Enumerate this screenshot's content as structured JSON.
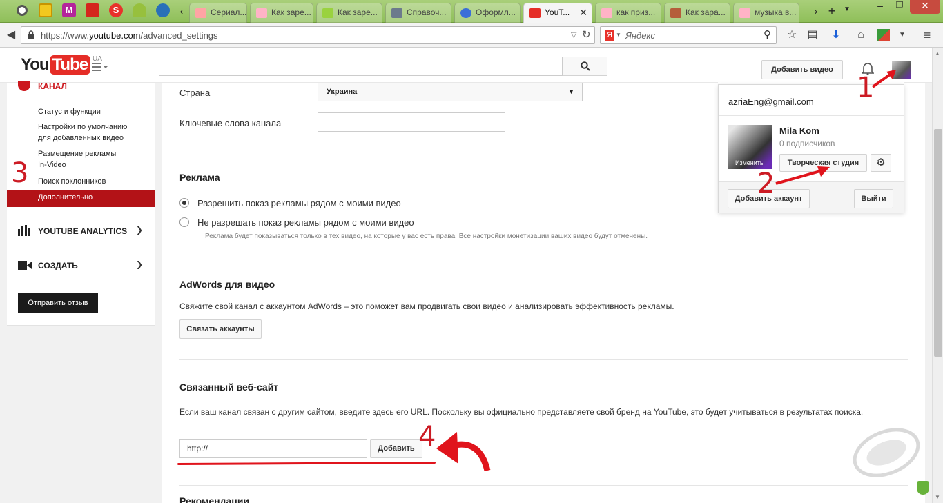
{
  "browser": {
    "tabs": [
      {
        "label": "Сериал...",
        "color": "#ffa4a4"
      },
      {
        "label": "Как заре...",
        "color": "#ffb3c6"
      },
      {
        "label": "Как заре...",
        "color": "#9ad23f"
      },
      {
        "label": "Справоч...",
        "color": "#6c7a8c"
      },
      {
        "label": "Оформл...",
        "color": "#3a6fd8"
      },
      {
        "label": "YouT...",
        "color": "#e52d27"
      },
      {
        "label": "как приз...",
        "color": "#ffb3c6"
      },
      {
        "label": "Как зара...",
        "color": "#b55d3a"
      },
      {
        "label": "музыка в...",
        "color": "#ffb3c6"
      }
    ],
    "url_prefix": "https://www.",
    "url_domain": "youtube.com",
    "url_path": "/advanced_settings",
    "yandex_placeholder": "Яндекс"
  },
  "header": {
    "logo_you": "You",
    "logo_tube": "Tube",
    "logo_region": "UA",
    "search_icon": "search-icon",
    "add_video": "Добавить видео"
  },
  "sidebar": {
    "section_channel": "КАНАЛ",
    "items": [
      "Статус и функции",
      "Настройки по умолчанию для добавленных видео",
      "Размещение рекламы In-Video",
      "Поиск поклонников",
      "Дополнительно"
    ],
    "analytics": "YOUTUBE ANALYTICS",
    "create": "СОЗДАТЬ",
    "feedback": "Отправить отзыв"
  },
  "main": {
    "country_label": "Страна",
    "country_value": "Украина",
    "keywords_label": "Ключевые слова канала",
    "ads_title": "Реклама",
    "ads_allow": "Разрешить показ рекламы рядом с моими видео",
    "ads_disallow": "Не разрешать показ рекламы рядом с моими видео",
    "ads_note": "Реклама будет показываться только в тех видео, на которые у вас есть права. Все настройки монетизации ваших видео будут отменены.",
    "adwords_title": "AdWords для видео",
    "adwords_text": "Свяжите свой канал с аккаунтом AdWords – это поможет вам продвигать свои видео и анализировать эффективность рекламы.",
    "adwords_button": "Связать аккаунты",
    "site_title": "Связанный веб-сайт",
    "site_text": "Если ваш канал связан с другим сайтом, введите здесь его URL. Поскольку вы официально представляете свой бренд на YouTube, это будет учитываться в результатах поиска.",
    "site_input": "http://",
    "site_button": "Добавить",
    "recommend_title": "Рекомендации"
  },
  "account": {
    "email": "azriaEng@gmail.com",
    "name": "Mila Kom",
    "subscribers": "0 подписчиков",
    "change": "Изменить",
    "studio": "Творческая студия",
    "add_account": "Добавить аккаунт",
    "logout": "Выйти"
  },
  "annotations": [
    "1",
    "2",
    "3",
    "4"
  ],
  "colors": {
    "youtube_red": "#e52d27",
    "active_item": "#b31217",
    "annotation": "#cc1b24",
    "tabstrip": "#9ecb6b"
  }
}
